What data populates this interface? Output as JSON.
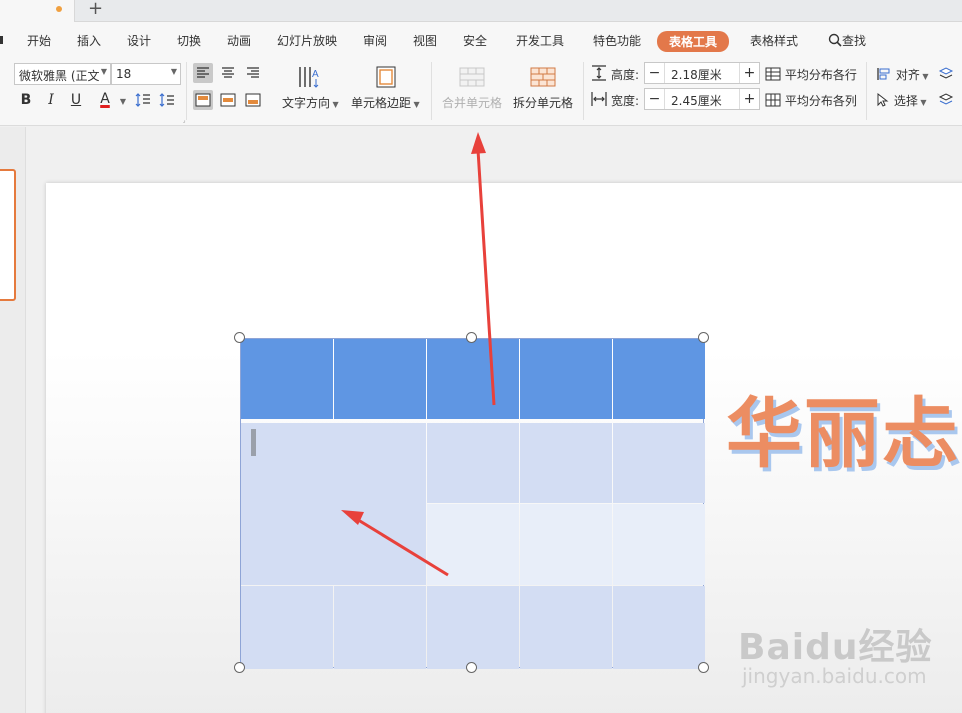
{
  "tabs": {
    "plus": "+"
  },
  "menu": {
    "items": [
      "开始",
      "插入",
      "设计",
      "切换",
      "动画",
      "幻灯片放映",
      "审阅",
      "视图",
      "安全",
      "开发工具",
      "特色功能",
      "表格工具",
      "表格样式"
    ],
    "active": "表格工具",
    "search": "查找"
  },
  "ribbon": {
    "font_name": "微软雅黑 (正文",
    "font_size": "18",
    "bold": "B",
    "italic": "I",
    "underline": "U",
    "font_color": "A",
    "text_direction": "文字方向",
    "cell_margins": "单元格边距",
    "merge_cells": "合并单元格",
    "split_cells": "拆分单元格",
    "height_label": "高度:",
    "height_value": "2.18厘米",
    "width_label": "宽度:",
    "width_value": "2.45厘米",
    "distribute_rows": "平均分布各行",
    "distribute_cols": "平均分布各列",
    "align": "对齐",
    "select": "选择",
    "minus": "−",
    "plus": "+"
  },
  "slide": {
    "title_text": "华丽忐"
  },
  "watermark": {
    "brand": "Baidu经验",
    "url": "jingyan.baidu.com"
  },
  "colors": {
    "accent": "#e3784a",
    "table_header": "#5f96e3",
    "table_body": "#d3ddf3",
    "table_body_alt": "#e8eef9",
    "arrow": "#e8413b"
  },
  "icons": [
    "bold-icon",
    "italic-icon",
    "underline-icon",
    "font-color-icon",
    "line-spacing-icon",
    "paragraph-spacing-icon",
    "align-left-icon",
    "align-center-icon",
    "align-right-icon",
    "align-top-icon",
    "align-middle-icon",
    "align-bottom-icon",
    "text-direction-icon",
    "cell-margin-icon",
    "merge-cells-icon",
    "split-cells-icon",
    "height-icon",
    "width-icon",
    "distribute-rows-icon",
    "distribute-cols-icon",
    "align-objects-icon",
    "select-cursor-icon",
    "search-icon"
  ]
}
